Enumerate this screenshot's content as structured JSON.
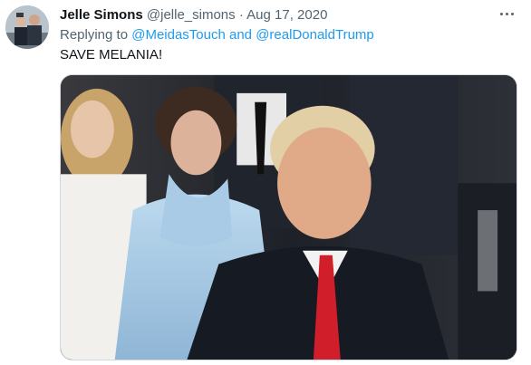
{
  "tweet": {
    "display_name": "Jelle Simons",
    "handle": "@jelle_simons",
    "separator": "·",
    "date": "Aug 17, 2020",
    "reply_prefix": "Replying to",
    "mention_1": "@MeidasTouch",
    "reply_and": "and",
    "mention_2": "@realDonaldTrump",
    "text_main": "SAVE MELANIA",
    "text_end": "!"
  },
  "icons": {
    "more": "more-options-icon"
  },
  "colors": {
    "link": "#1d9bf0",
    "secondary_text": "#536471",
    "primary_text": "#0f1419"
  }
}
